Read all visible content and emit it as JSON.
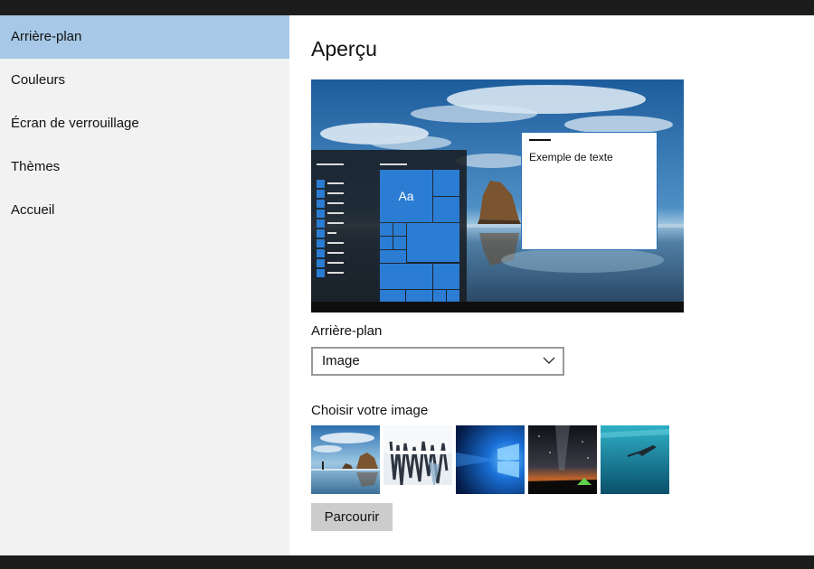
{
  "sidebar": {
    "items": [
      {
        "label": "Arrière-plan",
        "selected": true
      },
      {
        "label": "Couleurs"
      },
      {
        "label": "Écran de verrouillage"
      },
      {
        "label": "Thèmes"
      },
      {
        "label": "Accueil"
      }
    ]
  },
  "main": {
    "title": "Aperçu",
    "preview": {
      "tile_label": "Aa",
      "sample_text": "Exemple de texte"
    },
    "background": {
      "label": "Arrière-plan",
      "selected_value": "Image"
    },
    "choose_image": {
      "label": "Choisir votre image",
      "thumbnails": [
        {
          "name": "beach-rock"
        },
        {
          "name": "icy-waterfall"
        },
        {
          "name": "windows-logo-blue"
        },
        {
          "name": "night-sky-tent"
        },
        {
          "name": "underwater-swimmer"
        }
      ]
    },
    "browse_label": "Parcourir"
  },
  "colors": {
    "accent": "#2b7cd3",
    "sidebar_bg": "#f2f2f2",
    "selected_bg": "#a7c8e6",
    "button_bg": "#cccccc"
  }
}
